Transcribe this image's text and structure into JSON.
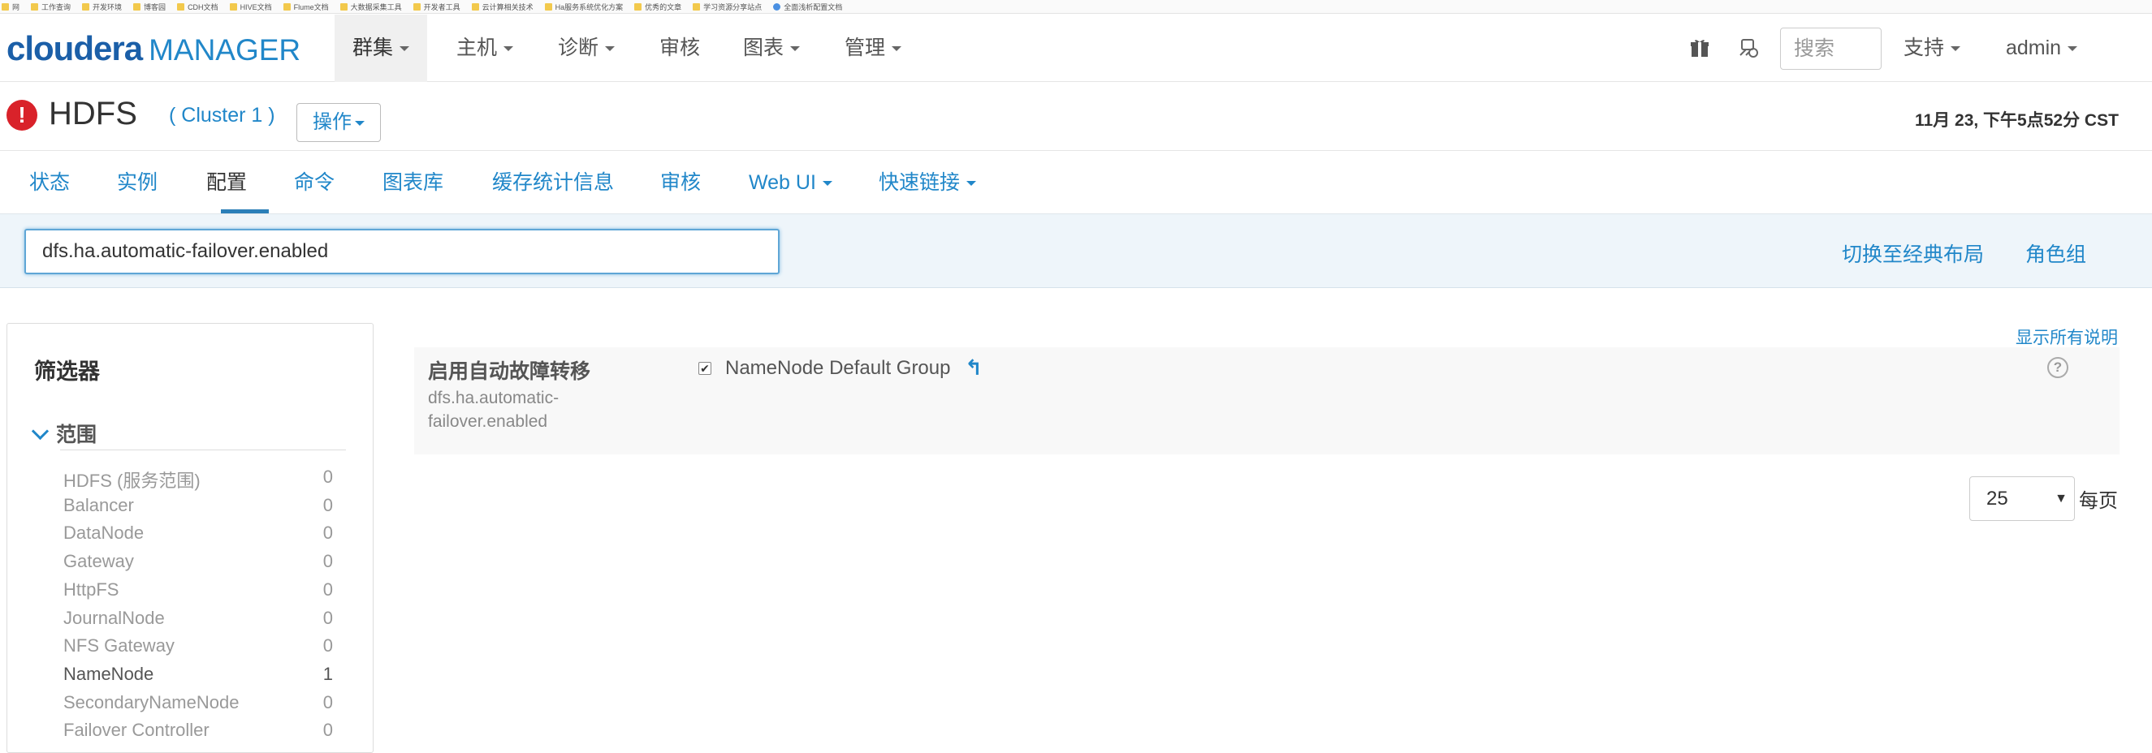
{
  "bookmarks": [
    "网",
    "工作查询",
    "开发环境",
    "博客园",
    "CDH文档",
    "HIVE文档",
    "Flume文档",
    "大数据采集工具",
    "开发者工具",
    "云计算相关技术",
    "Ha服务系统优化方案",
    "优秀的文章",
    "学习资源分享站点",
    "全面浅析配置文档"
  ],
  "brand": {
    "part1": "cloudera",
    "part2": "MANAGER"
  },
  "topnav": {
    "items": [
      {
        "label": "群集",
        "dropdown": true,
        "active": true
      },
      {
        "label": "主机",
        "dropdown": true
      },
      {
        "label": "诊断",
        "dropdown": true
      },
      {
        "label": "审核",
        "dropdown": false
      },
      {
        "label": "图表",
        "dropdown": true
      },
      {
        "label": "管理",
        "dropdown": true
      }
    ],
    "search_placeholder": "搜索",
    "support": "支持",
    "user": "admin"
  },
  "service": {
    "name": "HDFS",
    "cluster": "( Cluster 1 )",
    "actions": "操作",
    "timestamp": "11月 23, 下午5点52分 CST",
    "status_color": "#d9222a"
  },
  "tabs": [
    {
      "label": "状态"
    },
    {
      "label": "实例"
    },
    {
      "label": "配置",
      "active": true
    },
    {
      "label": "命令"
    },
    {
      "label": "图表库"
    },
    {
      "label": "缓存统计信息"
    },
    {
      "label": "审核"
    },
    {
      "label": "Web UI",
      "dropdown": true
    },
    {
      "label": "快速链接",
      "dropdown": true
    }
  ],
  "config": {
    "filter_value": "dfs.ha.automatic-failover.enabled",
    "switch_layout": "切换至经典布局",
    "role_groups": "角色组",
    "show_all_desc": "显示所有说明"
  },
  "sidebar": {
    "title": "筛选器",
    "scope_label": "范围",
    "scope_items": [
      {
        "label": "HDFS (服务范围)",
        "count": "0"
      },
      {
        "label": "Balancer",
        "count": "0"
      },
      {
        "label": "DataNode",
        "count": "0"
      },
      {
        "label": "Gateway",
        "count": "0"
      },
      {
        "label": "HttpFS",
        "count": "0"
      },
      {
        "label": "JournalNode",
        "count": "0"
      },
      {
        "label": "NFS Gateway",
        "count": "0"
      },
      {
        "label": "NameNode",
        "count": "1"
      },
      {
        "label": "SecondaryNameNode",
        "count": "0"
      },
      {
        "label": "Failover Controller",
        "count": "0"
      }
    ]
  },
  "property": {
    "label": "启用自动故障转移",
    "key_line1": "dfs.ha.automatic-",
    "key_line2": "failover.enabled",
    "checked": true,
    "group": "NameNode Default Group",
    "help_icon": "?"
  },
  "pagination": {
    "per_page_value": "25",
    "per_page_label": "每页"
  },
  "colors": {
    "accent": "#2187c9",
    "brand_dark": "#1b5fa8",
    "error": "#d9222a"
  }
}
